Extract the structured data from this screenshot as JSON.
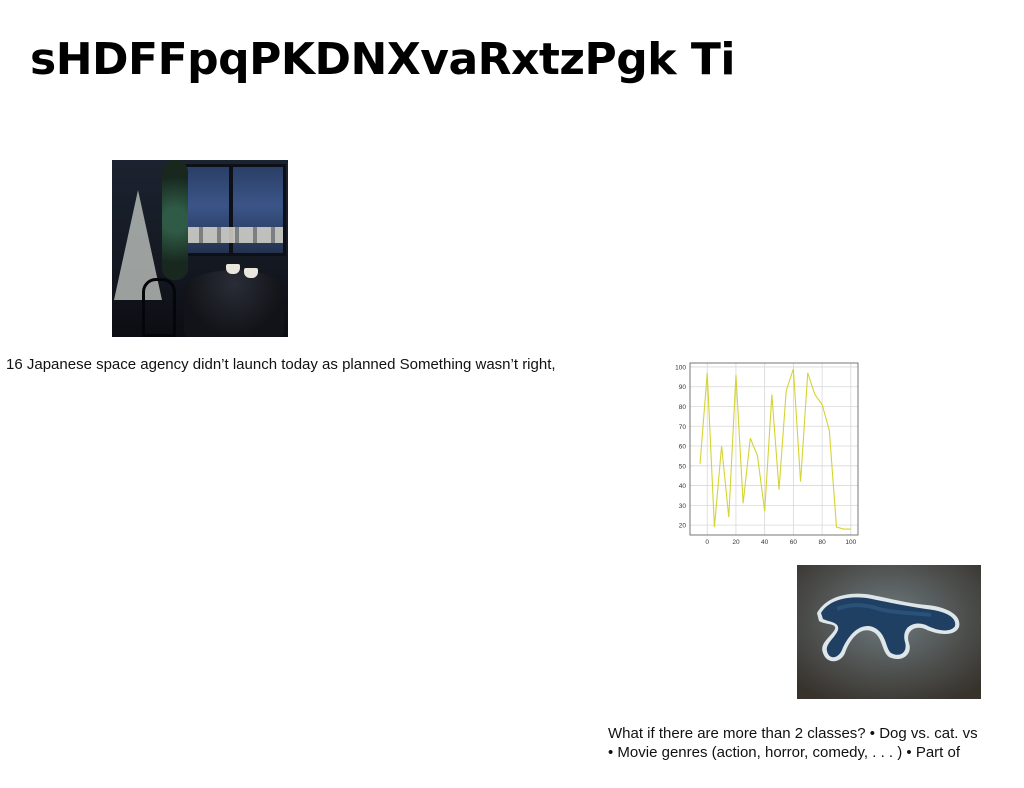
{
  "slide": {
    "title": "sHDFFpqPKDNXvaRxtzPgk Ti",
    "caption_1": "16 Japanese space agency didn’t launch today as planned Something wasn’t right,",
    "caption_2_lines": [
      "What if there are more than 2 classes? • Dog vs. cat. vs",
      "• Movie genres (action, horror, comedy, . . . ) • Part of"
    ]
  },
  "images": {
    "cafe_photo": "cafe-table-photo",
    "island_photo": "island-aerial-photo"
  },
  "chart_data": {
    "type": "line",
    "x": [
      -5,
      0,
      5,
      10,
      15,
      20,
      25,
      30,
      35,
      40,
      45,
      50,
      55,
      60,
      65,
      70,
      75,
      80,
      85,
      90,
      95,
      100
    ],
    "series": [
      {
        "values": [
          51,
          97,
          19,
          60,
          24,
          96,
          31,
          64,
          55,
          27,
          86,
          38,
          88,
          99,
          42,
          97,
          86,
          81,
          68,
          19,
          18,
          18
        ],
        "color": "#d4d433"
      }
    ],
    "x_ticks": [
      0,
      20,
      40,
      60,
      80,
      100
    ],
    "y_ticks": [
      20,
      30,
      40,
      50,
      60,
      70,
      80,
      90,
      100
    ],
    "xlim": [
      -12,
      105
    ],
    "ylim": [
      15,
      102
    ],
    "grid": true,
    "title": "",
    "xlabel": "",
    "ylabel": ""
  }
}
